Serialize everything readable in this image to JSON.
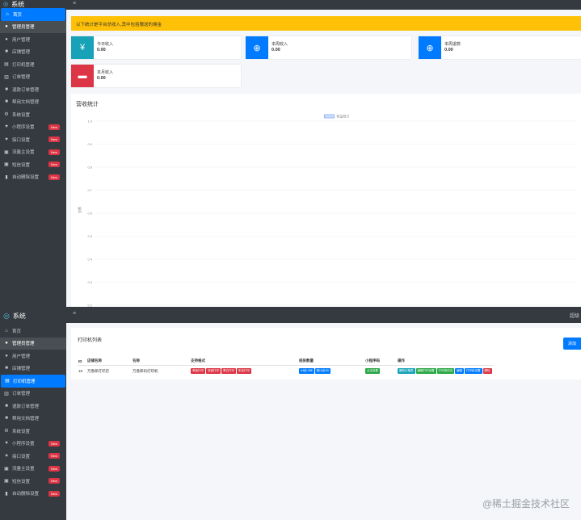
{
  "sidebar": {
    "brand": "系统",
    "items": [
      {
        "label": "首页",
        "icon": "home-icon"
      },
      {
        "label": "管理员管理",
        "icon": "user-tie-icon"
      },
      {
        "label": "用户管理",
        "icon": "user-icon"
      },
      {
        "label": "店铺管理",
        "icon": "store-icon"
      },
      {
        "label": "打印机管理",
        "icon": "printer-icon"
      },
      {
        "label": "订单管理",
        "icon": "order-icon"
      },
      {
        "label": "退款订单管理",
        "icon": "refund-icon"
      },
      {
        "label": "帮用文档管理",
        "icon": "document-icon"
      },
      {
        "label": "系统设置",
        "icon": "gear-icon"
      },
      {
        "label": "小程序设置",
        "icon": "heart-icon",
        "badge": "New"
      },
      {
        "label": "接口设置",
        "icon": "heart-icon",
        "badge": "New"
      },
      {
        "label": "流量主设置",
        "icon": "ad-icon",
        "badge": "New"
      },
      {
        "label": "短信设置",
        "icon": "sms-icon",
        "badge": "New"
      },
      {
        "label": "自动删除设置",
        "icon": "trash-icon",
        "badge": "New"
      }
    ]
  },
  "topbar": {
    "menu_icon": "≡",
    "right_text": "超级"
  },
  "dashboard": {
    "alert": "以下统计是平台总收入,其中包括赠送的佣金",
    "stats": [
      {
        "label": "今日收入",
        "value": "0.00",
        "icon": "¥",
        "color": "#17a2b8"
      },
      {
        "label": "本周收入",
        "value": "0.00",
        "icon": "magnifier-icon",
        "color": "#007bff"
      },
      {
        "label": "本周退款",
        "value": "0.00",
        "icon": "magnifier-icon",
        "color": "#007bff"
      },
      {
        "label": "本月收入",
        "value": "0.00",
        "icon": "wallet-icon",
        "color": "#dc3545"
      }
    ],
    "chart_title": "营收统计"
  },
  "chart_data": {
    "type": "line",
    "title": "营收统计",
    "legend": [
      "收益统计"
    ],
    "legend_position": "top-center",
    "ylabel": "金额",
    "ylim": [
      0.2,
      1.0
    ],
    "yticks": [
      "1.0",
      "0.9",
      "0.8",
      "0.7",
      "0.6",
      "0.5",
      "0.4",
      "0.3",
      "0.2"
    ],
    "series": [
      {
        "name": "收益统计",
        "values": []
      }
    ],
    "grid": true
  },
  "printers": {
    "title": "打印机列表",
    "add_button": "添加",
    "columns": [
      "ID",
      "店铺名称",
      "名称",
      "支持格式",
      "纸张数量",
      "小程序码",
      "操作"
    ],
    "rows": [
      {
        "id": "18",
        "shop": "万香郎打印店",
        "name": "万香郎码打印机",
        "formats": [
          {
            "label": "单面打印",
            "color": "#dc3545"
          },
          {
            "label": "双面打印",
            "color": "#dc3545"
          },
          {
            "label": "黑白打印",
            "color": "#dc3545"
          },
          {
            "label": "彩色打印",
            "color": "#dc3545"
          }
        ],
        "paper": [
          {
            "label": "A4纸:288",
            "color": "#007bff"
          },
          {
            "label": "照片纸:50",
            "color": "#007bff"
          }
        ],
        "qrcode": {
          "label": "点击查看",
          "color": "#28a745"
        },
        "actions": [
          {
            "label": "删除价格表",
            "color": "#17a2b8"
          },
          {
            "label": "编辑打印设置",
            "color": "#28a745"
          },
          {
            "label": "打印测试页",
            "color": "#28a745"
          },
          {
            "label": "编辑",
            "color": "#007bff"
          },
          {
            "label": "打印纸设置",
            "color": "#007bff"
          },
          {
            "label": "删除",
            "color": "#dc3545"
          }
        ]
      }
    ]
  },
  "watermark": "@稀土掘金技术社区"
}
